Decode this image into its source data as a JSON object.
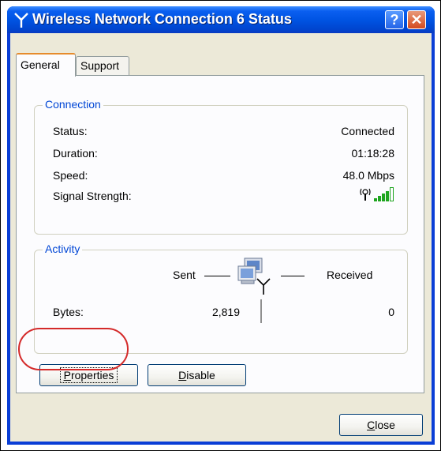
{
  "window": {
    "title": "Wireless Network Connection 6 Status",
    "help_label": "?",
    "close_label": "✕"
  },
  "tabs": [
    {
      "label": "General",
      "active": true
    },
    {
      "label": "Support",
      "active": false
    }
  ],
  "connection": {
    "legend": "Connection",
    "rows": [
      {
        "label": "Status:",
        "value": "Connected"
      },
      {
        "label": "Duration:",
        "value": "01:18:28"
      },
      {
        "label": "Speed:",
        "value": "48.0 Mbps"
      },
      {
        "label": "Signal Strength:",
        "value": ""
      }
    ],
    "signal_bars": 4,
    "signal_bars_total": 5
  },
  "activity": {
    "legend": "Activity",
    "sent_label": "Sent",
    "received_label": "Received",
    "bytes_label": "Bytes:",
    "bytes_sent": "2,819",
    "bytes_received": "0"
  },
  "buttons": {
    "properties": {
      "first": "P",
      "rest": "roperties"
    },
    "disable": {
      "first": "D",
      "rest": "isable"
    },
    "close": {
      "first": "C",
      "rest": "lose"
    }
  },
  "colors": {
    "titlebar": "#0054e3",
    "group_legend": "#0046d5",
    "highlight_ring": "#d42a2a",
    "signal": "#1fa51f"
  }
}
